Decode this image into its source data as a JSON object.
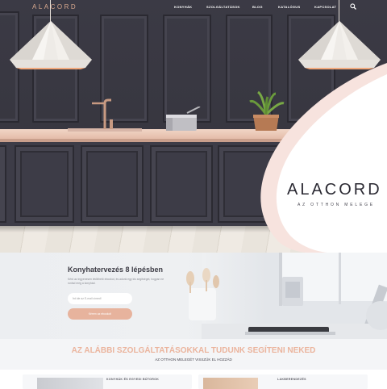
{
  "brand": {
    "logo": "ALACORD",
    "title": "ALACORD",
    "tagline": "AZ OTTHON MELEGE"
  },
  "nav": {
    "items": [
      "KONYHÁK",
      "SZOLGÁLTATÁSOK",
      "BLOG",
      "KATALÓGUS",
      "KAPCSOLAT"
    ]
  },
  "steps": {
    "title": "Konyhatervezés 8 lépésben",
    "text": "Kérd az ingyenesen letölthető ebookot, és adunk egy kis segítséget, hogyan ne rontsd meg a konyhád.",
    "email_placeholder": "Írd ide az E-mail címed!",
    "button_label": "Kérem az ebookot!"
  },
  "services": {
    "title": "AZ ALÁBBI SZOLGÁLTATÁSOKKAL TUDUNK SEGÍTENI NEKED",
    "subtitle": "AZ OTTHON MELEGÉT VISSZÜK EL HOZZÁD"
  },
  "cards": [
    {
      "title": "KONYHÁK ÉS EGYEDI BÚTOROK"
    },
    {
      "title": "LAKBERENDEZÉS"
    }
  ],
  "colors": {
    "accent": "#e7b39d",
    "dark": "#3b3a45",
    "pink": "#f7e4df"
  }
}
